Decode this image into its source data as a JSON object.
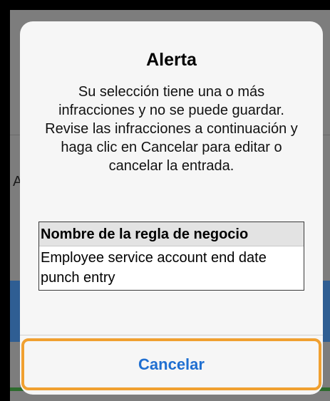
{
  "background": {
    "left_fragment": "Ag",
    "right_fragment": ""
  },
  "alert": {
    "title": "Alerta",
    "message": "Su selección tiene una o más infracciones y no se puede guardar. Revise las infracciones a continuación y haga clic en Cancelar para editar o cancelar la entrada.",
    "table": {
      "header": "Nombre de la regla de negocio",
      "rows": [
        "Employee service account end date punch entry"
      ]
    },
    "cancel_label": "Cancelar"
  },
  "colors": {
    "accent_button_text": "#1f6fd1",
    "highlight_outline": "#f0a030"
  }
}
